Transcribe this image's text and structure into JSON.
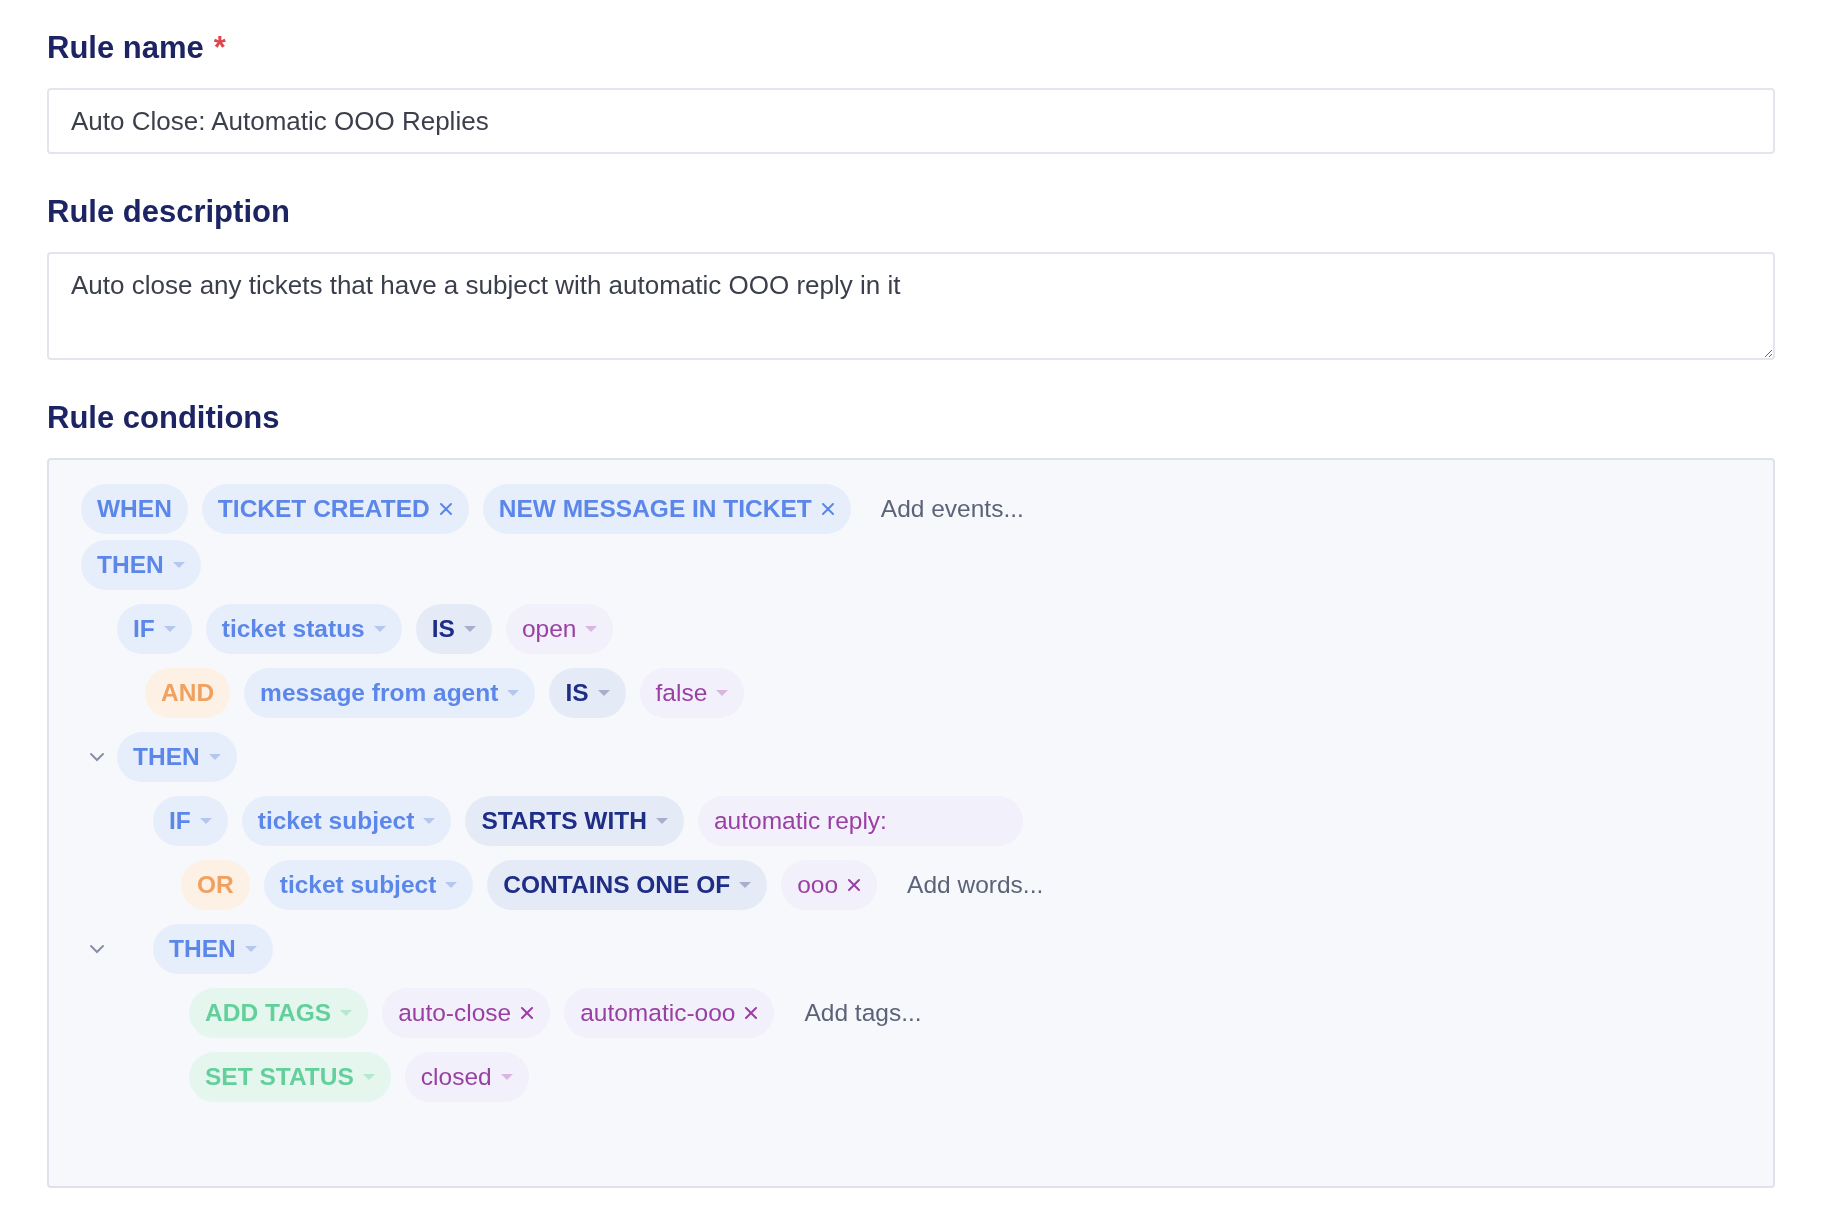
{
  "rule_name": {
    "label": "Rule name",
    "required_mark": "*",
    "value": "Auto Close: Automatic OOO Replies"
  },
  "rule_description": {
    "label": "Rule description",
    "value": "Auto close any tickets that have a subject with automatic OOO reply in it"
  },
  "rule_conditions": {
    "label": "Rule conditions",
    "rows": [
      {
        "chips": [
          {
            "kind": "keyword",
            "text": "WHEN",
            "dropdown": false,
            "removable": false
          },
          {
            "kind": "field",
            "text": "TICKET CREATED",
            "dropdown": false,
            "removable": true
          },
          {
            "kind": "field",
            "text": "NEW MESSAGE IN TICKET",
            "dropdown": false,
            "removable": true
          },
          {
            "kind": "add",
            "placeholder": "Add events..."
          }
        ]
      },
      {
        "chips": [
          {
            "kind": "keyword",
            "text": "THEN",
            "dropdown": true,
            "removable": false
          }
        ],
        "children": [
          {
            "chips": [
              {
                "kind": "keyword",
                "text": "IF",
                "dropdown": true,
                "removable": false
              },
              {
                "kind": "field",
                "text": "ticket status",
                "dropdown": true,
                "removable": false
              },
              {
                "kind": "operator",
                "text": "IS",
                "dropdown": true,
                "removable": false
              },
              {
                "kind": "value",
                "text": "open",
                "dropdown": true,
                "removable": false
              }
            ],
            "children": [
              {
                "chips": [
                  {
                    "kind": "connector",
                    "text": "AND",
                    "dropdown": false,
                    "removable": false
                  },
                  {
                    "kind": "field",
                    "text": "message from agent",
                    "dropdown": true,
                    "removable": false
                  },
                  {
                    "kind": "operator",
                    "text": "IS",
                    "dropdown": true,
                    "removable": false
                  },
                  {
                    "kind": "value",
                    "text": "false",
                    "dropdown": true,
                    "removable": false
                  }
                ]
              }
            ]
          },
          {
            "expanded": true,
            "chips": [
              {
                "kind": "keyword",
                "text": "THEN",
                "dropdown": true,
                "removable": false
              }
            ],
            "children": [
              {
                "chips": [
                  {
                    "kind": "keyword",
                    "text": "IF",
                    "dropdown": true,
                    "removable": false
                  },
                  {
                    "kind": "field",
                    "text": "ticket subject",
                    "dropdown": true,
                    "removable": false
                  },
                  {
                    "kind": "operator",
                    "text": "STARTS WITH",
                    "dropdown": true,
                    "removable": false
                  },
                  {
                    "kind": "input",
                    "value": "automatic reply:"
                  }
                ],
                "children": [
                  {
                    "chips": [
                      {
                        "kind": "connector",
                        "text": "OR",
                        "dropdown": false,
                        "removable": false
                      },
                      {
                        "kind": "field",
                        "text": "ticket subject",
                        "dropdown": true,
                        "removable": false
                      },
                      {
                        "kind": "operator",
                        "text": "CONTAINS ONE OF",
                        "dropdown": true,
                        "removable": false
                      },
                      {
                        "kind": "value",
                        "text": "ooo",
                        "dropdown": false,
                        "removable": true
                      },
                      {
                        "kind": "add",
                        "placeholder": "Add words..."
                      }
                    ]
                  }
                ]
              },
              {
                "expanded": true,
                "chips": [
                  {
                    "kind": "keyword",
                    "text": "THEN",
                    "dropdown": true,
                    "removable": false
                  }
                ],
                "children": [
                  {
                    "chips": [
                      {
                        "kind": "action",
                        "text": "ADD TAGS",
                        "dropdown": true,
                        "removable": false
                      },
                      {
                        "kind": "value",
                        "text": "auto-close",
                        "dropdown": false,
                        "removable": true
                      },
                      {
                        "kind": "value",
                        "text": "automatic-ooo",
                        "dropdown": false,
                        "removable": true
                      },
                      {
                        "kind": "add",
                        "placeholder": "Add tags..."
                      }
                    ]
                  },
                  {
                    "chips": [
                      {
                        "kind": "action",
                        "text": "SET STATUS",
                        "dropdown": true,
                        "removable": false
                      },
                      {
                        "kind": "value",
                        "text": "closed",
                        "dropdown": true,
                        "removable": false
                      }
                    ]
                  }
                ]
              }
            ]
          }
        ]
      }
    ]
  }
}
